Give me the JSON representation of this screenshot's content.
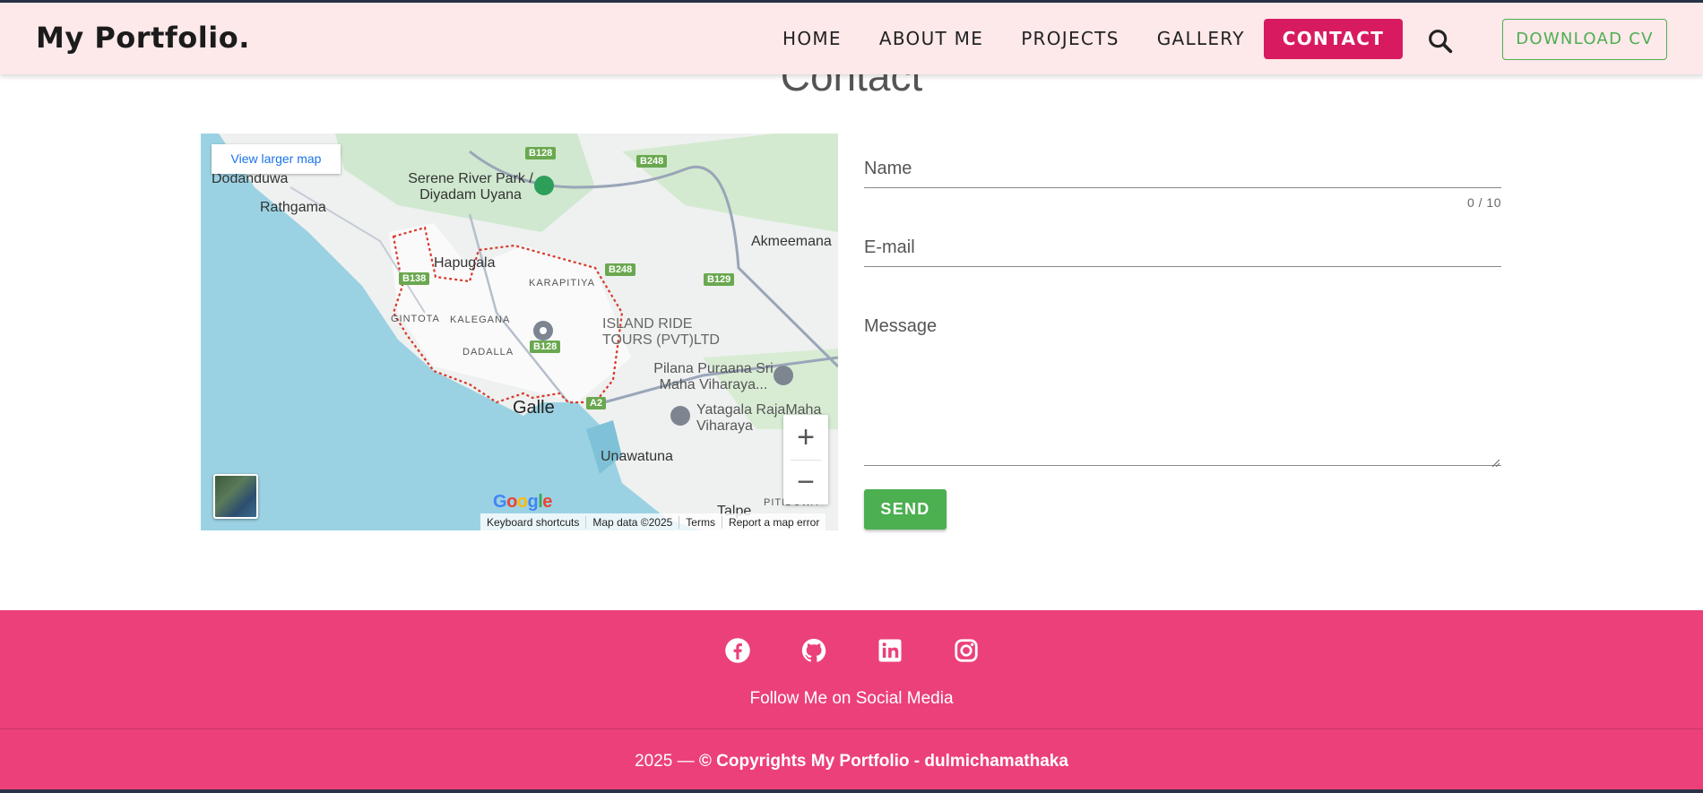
{
  "header": {
    "brand": "My Portfolio.",
    "nav": [
      {
        "label": "HOME"
      },
      {
        "label": "ABOUT ME"
      },
      {
        "label": "PROJECTS"
      },
      {
        "label": "GALLERY"
      },
      {
        "label": "CONTACT",
        "active": true
      }
    ],
    "search_icon": "search-icon",
    "cv_button": "DOWNLOAD CV"
  },
  "page": {
    "title": "Contact"
  },
  "map": {
    "larger_map_link": "View larger map",
    "places": [
      "Dodanduwa",
      "Rathgama",
      "Serene River Park / Diyadam Uyana",
      "Hapugala",
      "KARAPITIYA",
      "GINTOTA",
      "KALEGANA",
      "DADALLA",
      "ISLAND RIDE TOURS (PVT)LTD",
      "Pilana Puraana Sri Maha Viharaya...",
      "Galle",
      "Yatagala RajaMaha Viharaya",
      "Unawatuna",
      "Akmeemana",
      "Talpe",
      "PITIDUWA"
    ],
    "roads": [
      "B128",
      "B248",
      "B248",
      "B129",
      "B138",
      "B128",
      "A2"
    ],
    "zoom_in": "+",
    "zoom_out": "−",
    "google": "Google",
    "attribution": [
      "Keyboard shortcuts",
      "Map data ©2025",
      "Terms",
      "Report a map error"
    ]
  },
  "form": {
    "name_label": "Name",
    "name_counter": "0 / 10",
    "email_label": "E-mail",
    "message_label": "Message",
    "send": "SEND"
  },
  "footer": {
    "socials": [
      "facebook-icon",
      "github-icon",
      "linkedin-icon",
      "instagram-icon"
    ],
    "follow": "Follow Me on Social Media",
    "copyright_prefix": "2025 — ",
    "copyright_bold": "© Copyrights My Portfolio - dulmichamathaka"
  },
  "colors": {
    "header_bg": "#fde8ea",
    "accent": "#d81b60",
    "green": "#4caf50",
    "footer_bg": "#ec407a"
  }
}
